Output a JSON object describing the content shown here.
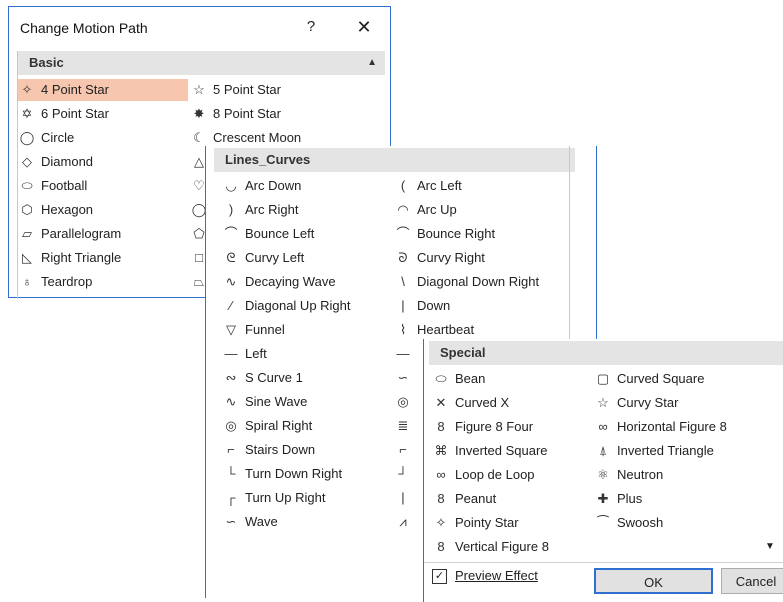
{
  "dialog": {
    "title": "Change Motion Path",
    "help": "?",
    "close": "✕"
  },
  "basic": {
    "header": "Basic",
    "scroll_up": "▲",
    "left": [
      {
        "label": "4 Point Star",
        "icon": "star4-icon",
        "glyph": "✧",
        "selected": true
      },
      {
        "label": "6 Point Star",
        "icon": "star6-icon",
        "glyph": "✡"
      },
      {
        "label": "Circle",
        "icon": "circle-icon",
        "glyph": "◯"
      },
      {
        "label": "Diamond",
        "icon": "diamond-icon",
        "glyph": "◇"
      },
      {
        "label": "Football",
        "icon": "football-icon",
        "glyph": "⬭"
      },
      {
        "label": "Hexagon",
        "icon": "hexagon-icon",
        "glyph": "⬡"
      },
      {
        "label": "Parallelogram",
        "icon": "parallelogram-icon",
        "glyph": "▱"
      },
      {
        "label": "Right Triangle",
        "icon": "right-triangle-icon",
        "glyph": "◺"
      },
      {
        "label": "Teardrop",
        "icon": "teardrop-icon",
        "glyph": "♁"
      }
    ],
    "right": [
      {
        "label": "5 Point Star",
        "icon": "star5-icon",
        "glyph": "☆"
      },
      {
        "label": "8 Point Star",
        "icon": "star8-icon",
        "glyph": "✸"
      },
      {
        "label": "Crescent Moon",
        "icon": "crescent-moon-icon",
        "glyph": "☾"
      },
      {
        "label": "",
        "icon": "triangle-icon",
        "glyph": "△"
      },
      {
        "label": "",
        "icon": "heart-icon",
        "glyph": "♡"
      },
      {
        "label": "",
        "icon": "octagon-icon",
        "glyph": "◯"
      },
      {
        "label": "",
        "icon": "pentagon-icon",
        "glyph": "⬠"
      },
      {
        "label": "",
        "icon": "square-icon",
        "glyph": "□"
      },
      {
        "label": "",
        "icon": "trapezoid-icon",
        "glyph": "⏢"
      }
    ]
  },
  "lines": {
    "header": "Lines_Curves",
    "left": [
      {
        "label": "Arc Down",
        "icon": "arc-down-icon",
        "glyph": "◡"
      },
      {
        "label": "Arc Right",
        "icon": "arc-right-icon",
        "glyph": ")"
      },
      {
        "label": "Bounce Left",
        "icon": "bounce-left-icon",
        "glyph": "⌒"
      },
      {
        "label": "Curvy Left",
        "icon": "curvy-left-icon",
        "glyph": "ᘓ"
      },
      {
        "label": "Decaying Wave",
        "icon": "decaying-wave-icon",
        "glyph": "∿"
      },
      {
        "label": "Diagonal Up Right",
        "icon": "diagonal-up-right-icon",
        "glyph": "⁄"
      },
      {
        "label": "Funnel",
        "icon": "funnel-icon",
        "glyph": "▽"
      },
      {
        "label": "Left",
        "icon": "left-icon",
        "glyph": "—"
      },
      {
        "label": "S Curve 1",
        "icon": "s-curve-icon",
        "glyph": "∾"
      },
      {
        "label": "Sine Wave",
        "icon": "sine-wave-icon",
        "glyph": "∿"
      },
      {
        "label": "Spiral Right",
        "icon": "spiral-right-icon",
        "glyph": "◎"
      },
      {
        "label": "Stairs Down",
        "icon": "stairs-down-icon",
        "glyph": "⌐"
      },
      {
        "label": "Turn Down Right",
        "icon": "turn-down-right-icon",
        "glyph": "└"
      },
      {
        "label": "Turn Up Right",
        "icon": "turn-up-right-icon",
        "glyph": "┌"
      },
      {
        "label": "Wave",
        "icon": "wave-icon",
        "glyph": "∽"
      }
    ],
    "right": [
      {
        "label": "Arc Left",
        "icon": "arc-left-icon",
        "glyph": "("
      },
      {
        "label": "Arc Up",
        "icon": "arc-up-icon",
        "glyph": "◠"
      },
      {
        "label": "Bounce Right",
        "icon": "bounce-right-icon",
        "glyph": "⌒"
      },
      {
        "label": "Curvy Right",
        "icon": "curvy-right-icon",
        "glyph": "ᘐ"
      },
      {
        "label": "Diagonal Down Right",
        "icon": "diagonal-down-right-icon",
        "glyph": "\\"
      },
      {
        "label": "Down",
        "icon": "down-icon",
        "glyph": "|"
      },
      {
        "label": "Heartbeat",
        "icon": "heartbeat-icon",
        "glyph": "⌇"
      },
      {
        "label": "",
        "icon": "right-icon",
        "glyph": "—"
      },
      {
        "label": "",
        "icon": "s-curve-2-icon",
        "glyph": "∽"
      },
      {
        "label": "",
        "icon": "spiral-left-icon",
        "glyph": "◎"
      },
      {
        "label": "",
        "icon": "spring-icon",
        "glyph": "≣"
      },
      {
        "label": "",
        "icon": "stairs-icon",
        "glyph": "⌐"
      },
      {
        "label": "",
        "icon": "turn-icon",
        "glyph": "┘"
      },
      {
        "label": "",
        "icon": "up-icon",
        "glyph": "|"
      },
      {
        "label": "",
        "icon": "zigzag-icon",
        "glyph": "⩘"
      }
    ]
  },
  "special": {
    "header": "Special",
    "scroll_down": "▼",
    "left": [
      {
        "label": "Bean",
        "icon": "bean-icon",
        "glyph": "⬭"
      },
      {
        "label": "Curved X",
        "icon": "curved-x-icon",
        "glyph": "✕"
      },
      {
        "label": "Figure 8 Four",
        "icon": "figure-8-four-icon",
        "glyph": "8"
      },
      {
        "label": "Inverted Square",
        "icon": "inverted-square-icon",
        "glyph": "⌘"
      },
      {
        "label": "Loop de Loop",
        "icon": "loop-de-loop-icon",
        "glyph": "∞"
      },
      {
        "label": "Peanut",
        "icon": "peanut-icon",
        "glyph": "8"
      },
      {
        "label": "Pointy Star",
        "icon": "pointy-star-icon",
        "glyph": "✧"
      },
      {
        "label": "Vertical Figure 8",
        "icon": "vertical-figure-8-icon",
        "glyph": "8"
      }
    ],
    "right": [
      {
        "label": "Curved Square",
        "icon": "curved-square-icon",
        "glyph": "▢"
      },
      {
        "label": "Curvy Star",
        "icon": "curvy-star-icon",
        "glyph": "☆"
      },
      {
        "label": "Horizontal Figure 8",
        "icon": "horizontal-figure-8-icon",
        "glyph": "∞"
      },
      {
        "label": "Inverted Triangle",
        "icon": "inverted-triangle-icon",
        "glyph": "⍋"
      },
      {
        "label": "Neutron",
        "icon": "neutron-icon",
        "glyph": "⚛"
      },
      {
        "label": "Plus",
        "icon": "plus-icon",
        "glyph": "✚"
      },
      {
        "label": "Swoosh",
        "icon": "swoosh-icon",
        "glyph": "⁀"
      }
    ]
  },
  "footer": {
    "preview_label": "Preview Effect",
    "preview_checked": true,
    "check_mark": "✓",
    "ok": "OK",
    "cancel": "Cancel"
  }
}
